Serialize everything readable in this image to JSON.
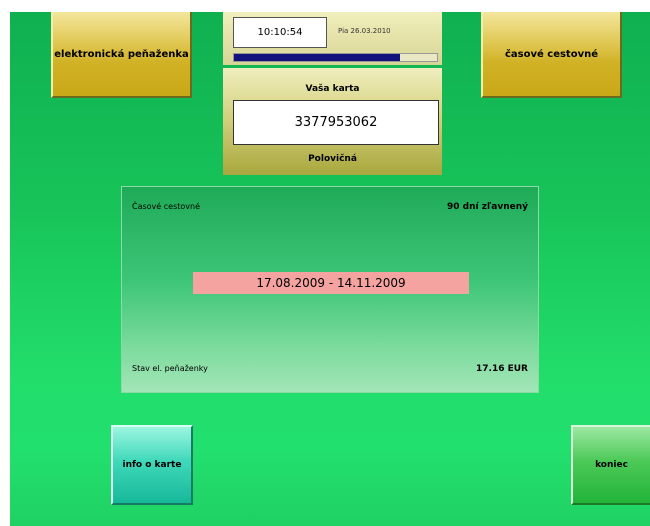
{
  "top_buttons": {
    "wallet_label": "elektronická peňaženka",
    "time_pass_label": "časové cestovné"
  },
  "status": {
    "time": "10:10:54",
    "date": "Pia 26.03.2010",
    "progress_percent": 82
  },
  "card": {
    "title": "Vaša karta",
    "number": "3377953062",
    "type": "Polovičná"
  },
  "info": {
    "pass_label": "Časové cestovné",
    "pass_type": "90 dní zľavnený",
    "validity": "17.08.2009 - 14.11.2009",
    "balance_label": "Stav el. peňaženky",
    "balance_value": "17.16 EUR"
  },
  "bottom_buttons": {
    "info_label": "info o karte",
    "end_label": "koniec"
  },
  "colors": {
    "background_green": "#1ccf60",
    "button_gold": "#d1b226",
    "progress_blue": "#12127a",
    "validity_pink": "#f5a3a0",
    "info_button_teal": "#3fd8ba",
    "end_button_green": "#4cc957"
  }
}
